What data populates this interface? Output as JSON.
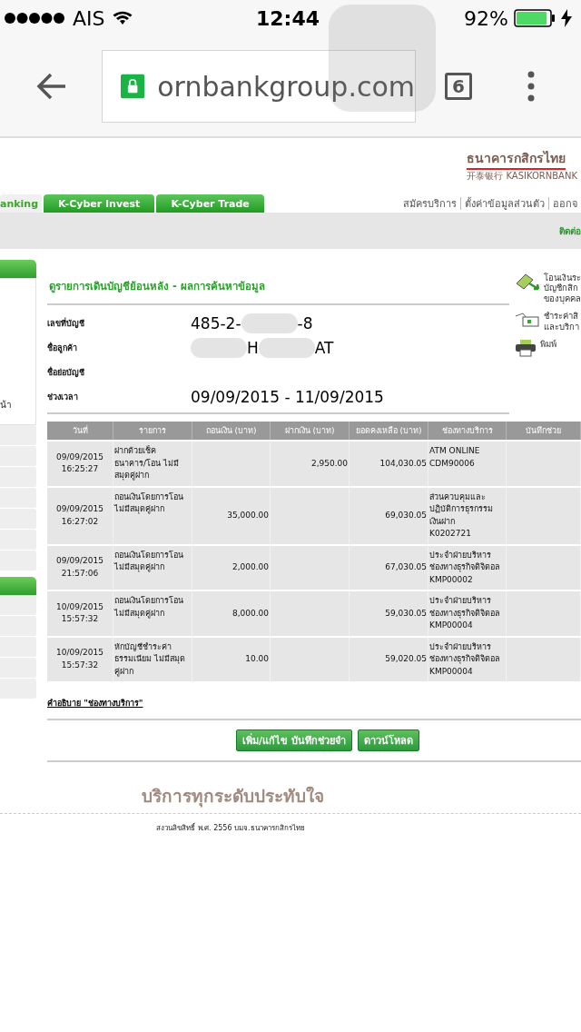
{
  "status_bar": {
    "carrier": "AIS",
    "time": "12:44",
    "battery": "92%",
    "charging": true
  },
  "browser": {
    "url": "ornbankgroup.com",
    "tab_count": "6"
  },
  "header": {
    "logo_thai": "ธนาคารกสิกรไทย",
    "logo_sub": "开泰银行 KASIKORNBANK"
  },
  "tabs": [
    {
      "label": "anking",
      "selected": true
    },
    {
      "label": "K-Cyber Invest",
      "selected": false
    },
    {
      "label": "K-Cyber Trade",
      "selected": false
    }
  ],
  "top_links": [
    "สมัครบริการ",
    "ตั้งค่าข้อมูลส่วนตัว",
    "ออกจ"
  ],
  "contact_link": "ติดต่อ",
  "sidebar": {
    "item_text": "น้า"
  },
  "page_title": "ดูรายการเดินบัญชีย้อนหลัง - ผลการค้นหาข้อมูล",
  "fields": [
    {
      "label": "เลขที่บัญชี",
      "kind": "masked",
      "parts": [
        "485-2-",
        "-8"
      ]
    },
    {
      "label": "ชื่อลูกค้า",
      "kind": "masked",
      "parts": [
        "H",
        "AT"
      ],
      "leading_mask": true
    },
    {
      "label": "ชื่อย่อบัญชี",
      "kind": "plain"
    },
    {
      "label": "ช่วงเวลา",
      "kind": "plain",
      "value": "09/09/2015 - 11/09/2015"
    }
  ],
  "side_actions": [
    {
      "kind": "transfer",
      "label": "โอนเงินระ\nบัญชีกสิก\nของบุคคล"
    },
    {
      "kind": "payment",
      "label": "ชำระค่าสิ\nและบริกา"
    },
    {
      "kind": "print",
      "label": "พิมพ์"
    }
  ],
  "table": {
    "columns": [
      "วันที่",
      "รายการ",
      "ถอนเงิน (บาท)",
      "ฝากเงิน (บาท)",
      "ยอดคงเหลือ (บาท)",
      "ช่องทางบริการ",
      "บันทึกช่วย"
    ],
    "rows": [
      {
        "date": "09/09/2015\n16:25:27",
        "description": "ฝากด้วยเช็ค\nธนาคาร/โอน ไม่มี\nสมุดคู่ฝาก",
        "deposit": "2,950.00",
        "balance": "104,030.05",
        "channel": "ATM ONLINE\nCDM90006"
      },
      {
        "date": "09/09/2015\n16:27:02",
        "description": "ถอนเงินโดยการโอน\nไม่มีสมุดคู่ฝาก",
        "withdrawal": "35,000.00",
        "balance": "69,030.05",
        "channel": "ส่วนควบคุมและ\nปฏิบัติการธุรกรรม\nเงินฝาก\nK0202721"
      },
      {
        "date": "09/09/2015\n21:57:06",
        "description": "ถอนเงินโดยการโอน\nไม่มีสมุดคู่ฝาก",
        "withdrawal": "2,000.00",
        "balance": "67,030.05",
        "channel": "ประจำฝ่ายบริหาร\nช่องทางธุรกิจดิจิตอล\nKMP00002"
      },
      {
        "date": "10/09/2015\n15:57:32",
        "description": "ถอนเงินโดยการโอน\nไม่มีสมุดคู่ฝาก",
        "withdrawal": "8,000.00",
        "balance": "59,030.05",
        "channel": "ประจำฝ่ายบริหาร\nช่องทางธุรกิจดิจิตอล\nKMP00004"
      },
      {
        "date": "10/09/2015\n15:57:32",
        "description": "หักบัญชีชำระค่า\nธรรมเนียม ไม่มีสมุด\nคู่ฝาก",
        "withdrawal": "10.00",
        "balance": "59,020.05",
        "channel": "ประจำฝ่ายบริหาร\nช่องทางธุรกิจดิจิตอล\nKMP00004"
      }
    ]
  },
  "legend_link": "คำอธิบาย \"ช่องทางบริการ\"",
  "buttons": [
    "เพิ่ม/แก้ไข บันทึกช่วยจำ",
    "ดาวน์โหลด"
  ],
  "slogan": "บริการทุกระดับประทับใจ",
  "copyright": "สงวนลิขสิทธิ์ พ.ศ. 2556 บมจ.ธนาคารกสิกรไทย"
}
